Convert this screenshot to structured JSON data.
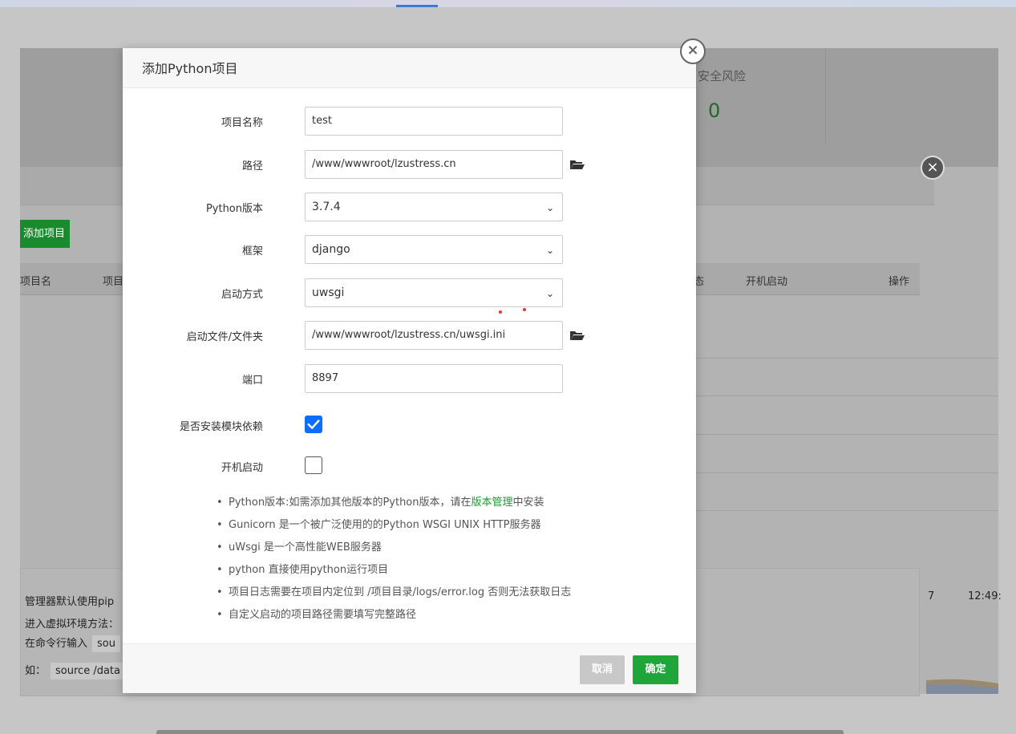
{
  "background": {
    "stat_card": {
      "label": "安全风险",
      "value": "0"
    },
    "add_button": "添加项目",
    "table_headers": [
      "项目名",
      "项目",
      "态",
      "开机启动",
      "操作"
    ],
    "info_lines": [
      "管理器默认使用pip",
      "进入虚拟环境方法：",
      "在命令行输入",
      "如："
    ],
    "info_code_1": "sou",
    "info_code_2": "source /data",
    "chart_times": [
      "7",
      "12:49:"
    ]
  },
  "modal": {
    "title": "添加Python项目",
    "fields": {
      "name": {
        "label": "项目名称",
        "value": "test"
      },
      "path": {
        "label": "路径",
        "value": "/www/wwwroot/lzustress.cn"
      },
      "python_version": {
        "label": "Python版本",
        "value": "3.7.4"
      },
      "framework": {
        "label": "框架",
        "value": "django"
      },
      "startup": {
        "label": "启动方式",
        "value": "uwsgi"
      },
      "startup_file": {
        "label": "启动文件/文件夹",
        "value": "/www/wwwroot/lzustress.cn/uwsgi.ini"
      },
      "port": {
        "label": "端口",
        "value": "8897"
      },
      "install_deps": {
        "label": "是否安装模块依赖",
        "checked": true
      },
      "autostart": {
        "label": "开机启动",
        "checked": false
      }
    },
    "tips": {
      "t1_prefix": "Python版本:如需添加其他版本的Python版本，请在",
      "t1_link": "版本管理",
      "t1_suffix": "中安装",
      "t2": "Gunicorn 是一个被广泛使用的的Python WSGI UNIX HTTP服务器",
      "t3": "uWsgi 是一个高性能WEB服务器",
      "t4": "python 直接使用python运行项目",
      "t5": "项目日志需要在项目内定位到 /项目目录/logs/error.log 否则无法获取日志",
      "t6": "自定义启动的项目路径需要填写完整路径"
    },
    "buttons": {
      "cancel": "取消",
      "ok": "确定"
    }
  },
  "colors": {
    "primary": "#20a53a",
    "checkbox": "#0d6efd",
    "link": "#1a9b2e"
  }
}
